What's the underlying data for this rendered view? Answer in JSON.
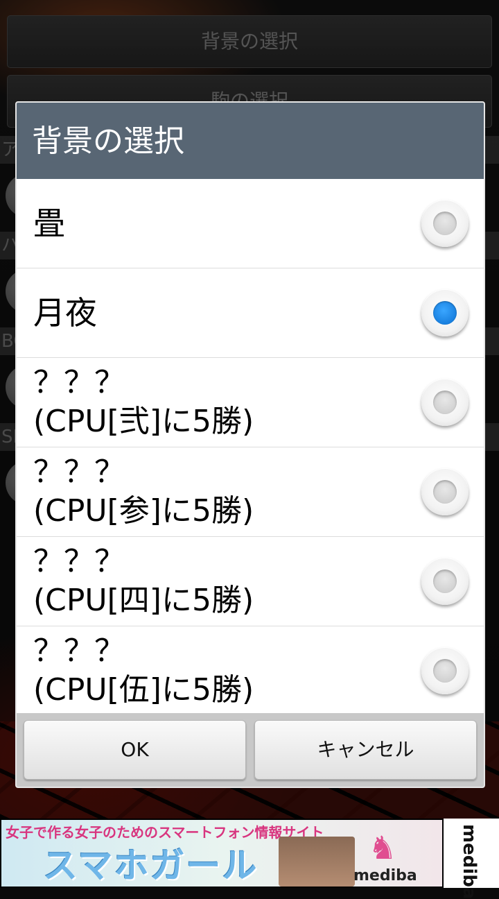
{
  "background_screen": {
    "button_background": "背景の選択",
    "button_piece": "駒の選択",
    "row_labels": [
      "ア",
      "ハ",
      "BG",
      "SE"
    ]
  },
  "dialog": {
    "title": "背景の選択",
    "options": [
      {
        "label": "畳",
        "checked": false
      },
      {
        "label": "月夜",
        "checked": true
      },
      {
        "label": "？？？\n(CPU[弐]に5勝)",
        "checked": false
      },
      {
        "label": "？？？\n(CPU[参]に5勝)",
        "checked": false
      },
      {
        "label": "？？？\n(CPU[四]に5勝)",
        "checked": false
      },
      {
        "label": "？？？\n(CPU[伍]に5勝)",
        "checked": false
      }
    ],
    "ok_label": "OK",
    "cancel_label": "キャンセル"
  },
  "ad": {
    "tagline": "女子で作る女子のためのスマートフォン情報サイト",
    "title": "スマホガール",
    "brand": "mediba"
  },
  "colors": {
    "title_bar": "#586674",
    "radio_selected": "#0a6fd1"
  }
}
